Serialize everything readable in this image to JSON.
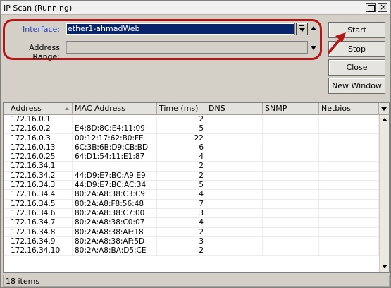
{
  "window": {
    "title": "IP Scan (Running)"
  },
  "form": {
    "interface_label": "Interface:",
    "interface_value": "ether1-ahmadWeb",
    "address_range_label": "Address Range:",
    "address_range_value": ""
  },
  "buttons": {
    "start": "Start",
    "stop": "Stop",
    "close": "Close",
    "new_window": "New Window"
  },
  "table": {
    "columns": [
      "Address",
      "MAC Address",
      "Time (ms)",
      "DNS",
      "SNMP",
      "Netbios"
    ],
    "rows": [
      {
        "address": "172.16.0.1",
        "mac": "",
        "time": "2",
        "dns": "",
        "snmp": "",
        "netbios": ""
      },
      {
        "address": "172.16.0.2",
        "mac": "E4:8D:8C:E4:11:09",
        "time": "5",
        "dns": "",
        "snmp": "",
        "netbios": ""
      },
      {
        "address": "172.16.0.3",
        "mac": "00:12:17:62:B0:FE",
        "time": "22",
        "dns": "",
        "snmp": "",
        "netbios": ""
      },
      {
        "address": "172.16.0.13",
        "mac": "6C:3B:6B:D9:CB:BD",
        "time": "6",
        "dns": "",
        "snmp": "",
        "netbios": ""
      },
      {
        "address": "172.16.0.25",
        "mac": "64:D1:54:11:E1:87",
        "time": "4",
        "dns": "",
        "snmp": "",
        "netbios": ""
      },
      {
        "address": "172.16.34.1",
        "mac": "",
        "time": "2",
        "dns": "",
        "snmp": "",
        "netbios": ""
      },
      {
        "address": "172.16.34.2",
        "mac": "44:D9:E7:BC:A9:E9",
        "time": "2",
        "dns": "",
        "snmp": "",
        "netbios": ""
      },
      {
        "address": "172.16.34.3",
        "mac": "44:D9:E7:BC:AC:34",
        "time": "5",
        "dns": "",
        "snmp": "",
        "netbios": ""
      },
      {
        "address": "172.16.34.4",
        "mac": "80:2A:A8:38:C3:C9",
        "time": "4",
        "dns": "",
        "snmp": "",
        "netbios": ""
      },
      {
        "address": "172.16.34.5",
        "mac": "80:2A:A8:F8:56:48",
        "time": "7",
        "dns": "",
        "snmp": "",
        "netbios": ""
      },
      {
        "address": "172.16.34.6",
        "mac": "80:2A:A8:38:C7:00",
        "time": "3",
        "dns": "",
        "snmp": "",
        "netbios": ""
      },
      {
        "address": "172.16.34.7",
        "mac": "80:2A:A8:38:C0:07",
        "time": "4",
        "dns": "",
        "snmp": "",
        "netbios": ""
      },
      {
        "address": "172.16.34.8",
        "mac": "80:2A:A8:38:AF:18",
        "time": "2",
        "dns": "",
        "snmp": "",
        "netbios": ""
      },
      {
        "address": "172.16.34.9",
        "mac": "80:2A:A8:38:AF:5D",
        "time": "3",
        "dns": "",
        "snmp": "",
        "netbios": ""
      },
      {
        "address": "172.16.34.10",
        "mac": "80:2A:A8:BA:D5:CE",
        "time": "2",
        "dns": "",
        "snmp": "",
        "netbios": ""
      }
    ]
  },
  "status": {
    "items_count": "18 items"
  },
  "colors": {
    "highlight_outline": "#b41616",
    "selection_bg": "#0a246a",
    "label_accent": "#2040c8"
  }
}
